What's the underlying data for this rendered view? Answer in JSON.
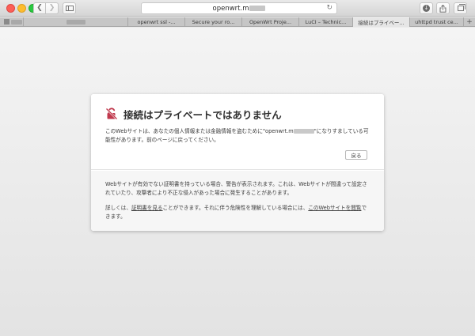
{
  "browser": {
    "url_visible": "openwrt.m",
    "tabs": [
      {
        "label": "",
        "kind": "blurred-favicon"
      },
      {
        "label": "",
        "kind": "blurred"
      },
      {
        "label": "openwrt ssl -...",
        "kind": "normal"
      },
      {
        "label": "Secure your ro...",
        "kind": "normal"
      },
      {
        "label": "OpenWrt Proje...",
        "kind": "normal"
      },
      {
        "label": "LuCI – Technic...",
        "kind": "normal"
      },
      {
        "label": "接続はプライベー...",
        "kind": "active"
      },
      {
        "label": "uhttpd trust ce...",
        "kind": "normal"
      }
    ],
    "new_tab_symbol": "+"
  },
  "error_page": {
    "title": "接続はプライベートではありません",
    "description_before": "このWebサイトは、あなたの個人情報または金融情報を盗むために\"openwrt.m",
    "description_after": "\"になりすましている可能性があります。前のページに戻ってください。",
    "back_button_label": "戻る",
    "detail_paragraph": "Webサイトが有効でない証明書を持っている場合、警告が表示されます。これは、Webサイトが間違って設定されていたり、攻撃者により不正な侵入があった場合に発生することがあります。",
    "detail_prefix": "詳しくは、",
    "show_certificate_link": "証明書を見る",
    "detail_middle": "ことができます。それに伴う危険性を理解している場合には、",
    "visit_site_link": "このWebサイトを閲覧",
    "detail_suffix": "できます。"
  },
  "colors": {
    "warning_icon": "#c0394d",
    "page_bg": "#ececec",
    "card_bg": "#ffffff",
    "card_lower_bg": "#f6f6f6"
  },
  "icons": {
    "back": "chevron-left-icon",
    "forward": "chevron-right-icon",
    "sidebar": "sidebar-icon",
    "reload": "reload-icon",
    "download": "download-icon",
    "share": "share-icon",
    "tabs": "tabs-overview-icon",
    "warning": "broken-lock-icon"
  }
}
